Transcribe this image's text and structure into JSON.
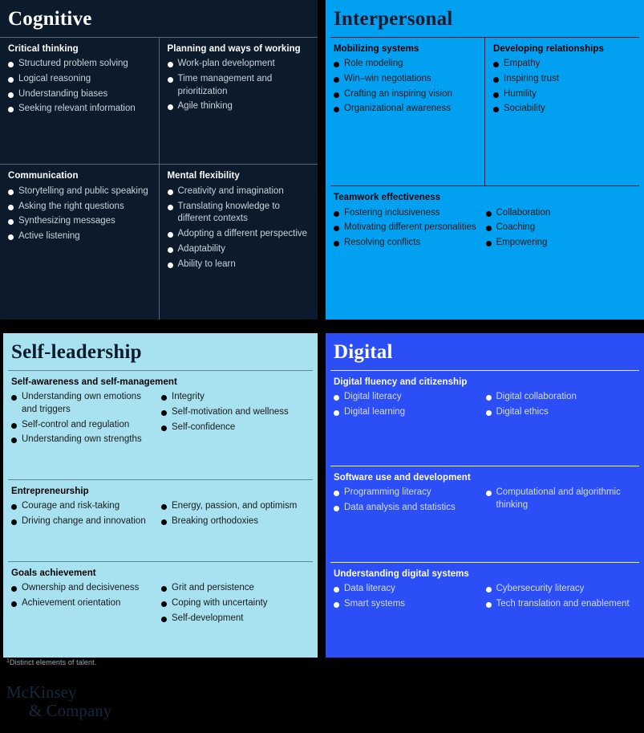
{
  "panels": {
    "cognitive": {
      "title": "Cognitive",
      "groups": [
        {
          "title": "Critical thinking",
          "items": [
            "Structured problem solving",
            "Logical reasoning",
            "Understanding biases",
            "Seeking relevant information"
          ]
        },
        {
          "title": "Planning and ways of working",
          "items": [
            "Work-plan development",
            "Time management and prioritization",
            "Agile thinking"
          ]
        },
        {
          "title": "Communication",
          "items": [
            "Storytelling and public speaking",
            "Asking the right questions",
            "Synthesizing messages",
            "Active listening"
          ]
        },
        {
          "title": "Mental flexibility",
          "items": [
            "Creativity and imagination",
            "Translating knowledge to different contexts",
            "Adopting a different perspective",
            "Adaptability",
            "Ability to learn"
          ]
        }
      ]
    },
    "interpersonal": {
      "title": "Interpersonal",
      "groups": [
        {
          "title": "Mobilizing systems",
          "items": [
            "Role modeling",
            "Win–win negotiations",
            "Crafting an inspiring vision",
            "Organizational awareness"
          ]
        },
        {
          "title": "Developing relationships",
          "items": [
            "Empathy",
            "Inspiring trust",
            "Humility",
            "Sociability"
          ]
        },
        {
          "title": "Teamwork effectiveness",
          "items_left": [
            "Fostering inclusiveness",
            "Motivating different personalities",
            "Resolving conflicts"
          ],
          "items_right": [
            "Collaboration",
            " Coaching",
            "Empowering"
          ]
        }
      ]
    },
    "self_leadership": {
      "title": "Self-leadership",
      "groups": [
        {
          "title": "Self-awareness and self-management",
          "items_left": [
            "Understanding own emotions and triggers",
            "Self-control and regulation",
            "Understanding own strengths"
          ],
          "items_right": [
            "Integrity",
            "Self-motivation and wellness",
            "Self-confidence"
          ]
        },
        {
          "title": "Entrepreneurship",
          "items_left": [
            "Courage and risk-taking",
            "Driving change and innovation"
          ],
          "items_right": [
            "Energy, passion, and optimism",
            "Breaking orthodoxies"
          ]
        },
        {
          "title": "Goals achievement",
          "items_left": [
            "Ownership and decisiveness",
            "Achievement orientation"
          ],
          "items_right": [
            "Grit and persistence",
            "Coping with uncertainty",
            "Self-development"
          ]
        }
      ]
    },
    "digital": {
      "title": "Digital",
      "groups": [
        {
          "title": "Digital fluency and citizenship",
          "items_left": [
            "Digital literacy",
            "Digital learning"
          ],
          "items_right": [
            "Digital collaboration",
            "Digital ethics"
          ]
        },
        {
          "title": "Software use and development",
          "items_left": [
            "Programming literacy",
            "Data analysis and statistics"
          ],
          "items_right": [
            "Computational and algorithmic thinking"
          ]
        },
        {
          "title": "Understanding digital systems",
          "items_left": [
            "Data literacy",
            "Smart systems"
          ],
          "items_right": [
            "Cybersecurity literacy",
            "Tech translation and enablement"
          ]
        }
      ]
    }
  },
  "footnote": {
    "marker": "1",
    "text": "Distinct elements of talent."
  },
  "logo": {
    "line1": "McKinsey",
    "line2": "& Company"
  },
  "colors": {
    "navy": "#0c1b2b",
    "cyan": "#02a0f0",
    "light_blue": "#a8e2f0",
    "royal_blue": "#2b4ef6",
    "background": "#000000"
  }
}
